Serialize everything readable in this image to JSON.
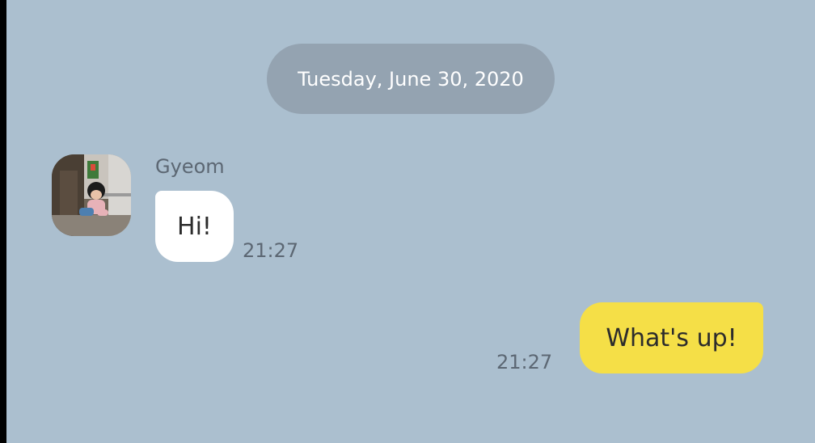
{
  "chat": {
    "date_separator": "Tuesday, June 30, 2020",
    "messages": [
      {
        "direction": "incoming",
        "sender": "Gyeom",
        "avatar": "user-photo",
        "text": "Hi!",
        "time": "21:27"
      },
      {
        "direction": "outgoing",
        "text": "What's up!",
        "time": "21:27"
      }
    ]
  },
  "colors": {
    "background": "#abbfcf",
    "date_pill": "#94a3b1",
    "incoming_bubble": "#ffffff",
    "outgoing_bubble": "#f5df47",
    "meta_text": "#5c6773",
    "message_text": "#2c2c2c"
  }
}
